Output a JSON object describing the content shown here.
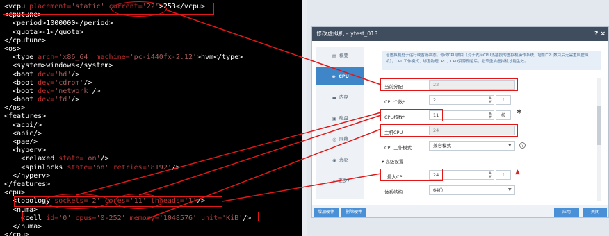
{
  "xml_lines": [
    [
      [
        "t",
        "<vcpu "
      ],
      [
        "a",
        "placement="
      ],
      [
        "v",
        "'static'"
      ],
      [
        "t",
        " "
      ],
      [
        "a",
        "current="
      ],
      [
        "v",
        "'22'"
      ],
      [
        "t",
        ">253</vcpu>"
      ]
    ],
    [
      [
        "t",
        "<cputune>"
      ]
    ],
    [
      [
        "t",
        "  <period>1000000</period>"
      ]
    ],
    [
      [
        "t",
        "  <quota>-1</quota>"
      ]
    ],
    [
      [
        "t",
        "</cputune>"
      ]
    ],
    [
      [
        "t",
        "<os>"
      ]
    ],
    [
      [
        "t",
        "  <type "
      ],
      [
        "a",
        "arch="
      ],
      [
        "v",
        "'x86_64'"
      ],
      [
        "t",
        " "
      ],
      [
        "a",
        "machine="
      ],
      [
        "v",
        "'pc-i440fx-2.12'"
      ],
      [
        "t",
        ">hvm</type>"
      ]
    ],
    [
      [
        "t",
        "  <system>windows</system>"
      ]
    ],
    [
      [
        "t",
        "  <boot "
      ],
      [
        "a",
        "dev="
      ],
      [
        "v",
        "'hd'"
      ],
      [
        "t",
        "/>"
      ]
    ],
    [
      [
        "t",
        "  <boot "
      ],
      [
        "a",
        "dev="
      ],
      [
        "v",
        "'cdrom'"
      ],
      [
        "t",
        "/>"
      ]
    ],
    [
      [
        "t",
        "  <boot "
      ],
      [
        "a",
        "dev="
      ],
      [
        "v",
        "'network'"
      ],
      [
        "t",
        "/>"
      ]
    ],
    [
      [
        "t",
        "  <boot "
      ],
      [
        "a",
        "dev="
      ],
      [
        "v",
        "'fd'"
      ],
      [
        "t",
        "/>"
      ]
    ],
    [
      [
        "t",
        "</os>"
      ]
    ],
    [
      [
        "t",
        "<features>"
      ]
    ],
    [
      [
        "t",
        "  <acpi/>"
      ]
    ],
    [
      [
        "t",
        "  <apic/>"
      ]
    ],
    [
      [
        "t",
        "  <pae/>"
      ]
    ],
    [
      [
        "t",
        "  <hyperv>"
      ]
    ],
    [
      [
        "t",
        "    <relaxed "
      ],
      [
        "a",
        "state="
      ],
      [
        "v",
        "'on'"
      ],
      [
        "t",
        "/>"
      ]
    ],
    [
      [
        "t",
        "    <spinlocks "
      ],
      [
        "a",
        "state="
      ],
      [
        "v",
        "'on'"
      ],
      [
        "t",
        " "
      ],
      [
        "a",
        "retries="
      ],
      [
        "v",
        "'8192'"
      ],
      [
        "t",
        "/>"
      ]
    ],
    [
      [
        "t",
        "  </hyperv>"
      ]
    ],
    [
      [
        "t",
        "</features>"
      ]
    ],
    [
      [
        "t",
        "<cpu>"
      ]
    ],
    [
      [
        "t",
        "  <topology "
      ],
      [
        "a",
        "sockets="
      ],
      [
        "v",
        "'2'"
      ],
      [
        "t",
        " "
      ],
      [
        "a",
        "cores="
      ],
      [
        "v",
        "'11'"
      ],
      [
        "t",
        " "
      ],
      [
        "a",
        "threads="
      ],
      [
        "v",
        "'1'"
      ],
      [
        "t",
        "/>"
      ]
    ],
    [
      [
        "t",
        "  <numa>"
      ]
    ],
    [
      [
        "t",
        "    <cell "
      ],
      [
        "a",
        "id="
      ],
      [
        "v",
        "'0'"
      ],
      [
        "t",
        " "
      ],
      [
        "a",
        "cpus="
      ],
      [
        "v",
        "'0-252'"
      ],
      [
        "t",
        " "
      ],
      [
        "a",
        "memory="
      ],
      [
        "v",
        "'1048576'"
      ],
      [
        "t",
        " "
      ],
      [
        "a",
        "unit="
      ],
      [
        "v",
        "'KiB'"
      ],
      [
        "t",
        "/>"
      ]
    ],
    [
      [
        "t",
        "  </numa>"
      ]
    ],
    [
      [
        "t",
        "</cpu>"
      ]
    ]
  ],
  "dialog": {
    "title": "修改虚拟机 – ytest_013",
    "close": "? ×",
    "info": "若虚拟机处于运行或暂停状态，修改CPU数目（对于支持CPU热插拔的虚拟机操作系统，增加CPU数目后无需重启虚拟机），CPU工作模式、绑定物理CPU、CPU资源预留后，必须重启虚拟机才能生效。",
    "nav": [
      {
        "label": "概要",
        "icon": "summary-icon",
        "active": false
      },
      {
        "label": "CPU",
        "icon": "cpu-icon",
        "active": true
      },
      {
        "label": "内存",
        "icon": "memory-icon",
        "active": false
      },
      {
        "label": "磁盘",
        "icon": "disk-icon",
        "active": false
      },
      {
        "label": "网络",
        "icon": "network-icon",
        "active": false
      },
      {
        "label": "光驱",
        "icon": "cdrom-icon",
        "active": false
      },
      {
        "label": "更多▾",
        "icon": "more-icon",
        "active": false
      }
    ],
    "fields": {
      "current_label": "当前分配",
      "current_value": "22",
      "cpu_count_label": "CPU个数*",
      "cpu_count_value": "2",
      "cpu_cores_label": "CPU核数*",
      "cpu_cores_value": "11",
      "cpu_cores_unit": "核",
      "host_cpu_label": "主机CPU",
      "host_cpu_value": "24",
      "work_mode_label": "CPU工作模式",
      "work_mode_value": "兼容模式",
      "advanced_label": "▾ 高级设置",
      "max_cpu_label": "最大CPU",
      "max_cpu_value": "24",
      "arch_label": "体系结构",
      "arch_value": "64位",
      "stepper_up": "▲",
      "stepper_down": "▼",
      "up_arrow": "↑"
    },
    "footer": {
      "add_hw": "增加硬件",
      "del_hw": "删除硬件",
      "apply": "应用",
      "close": "关闭"
    }
  },
  "colors": {
    "terminal_bg": "#000000",
    "xml_text": "#ffffff",
    "xml_attr": "#c03030",
    "annotation": "#e01818",
    "accent": "#3e86c8",
    "title_bar": "#3f4d5e"
  }
}
